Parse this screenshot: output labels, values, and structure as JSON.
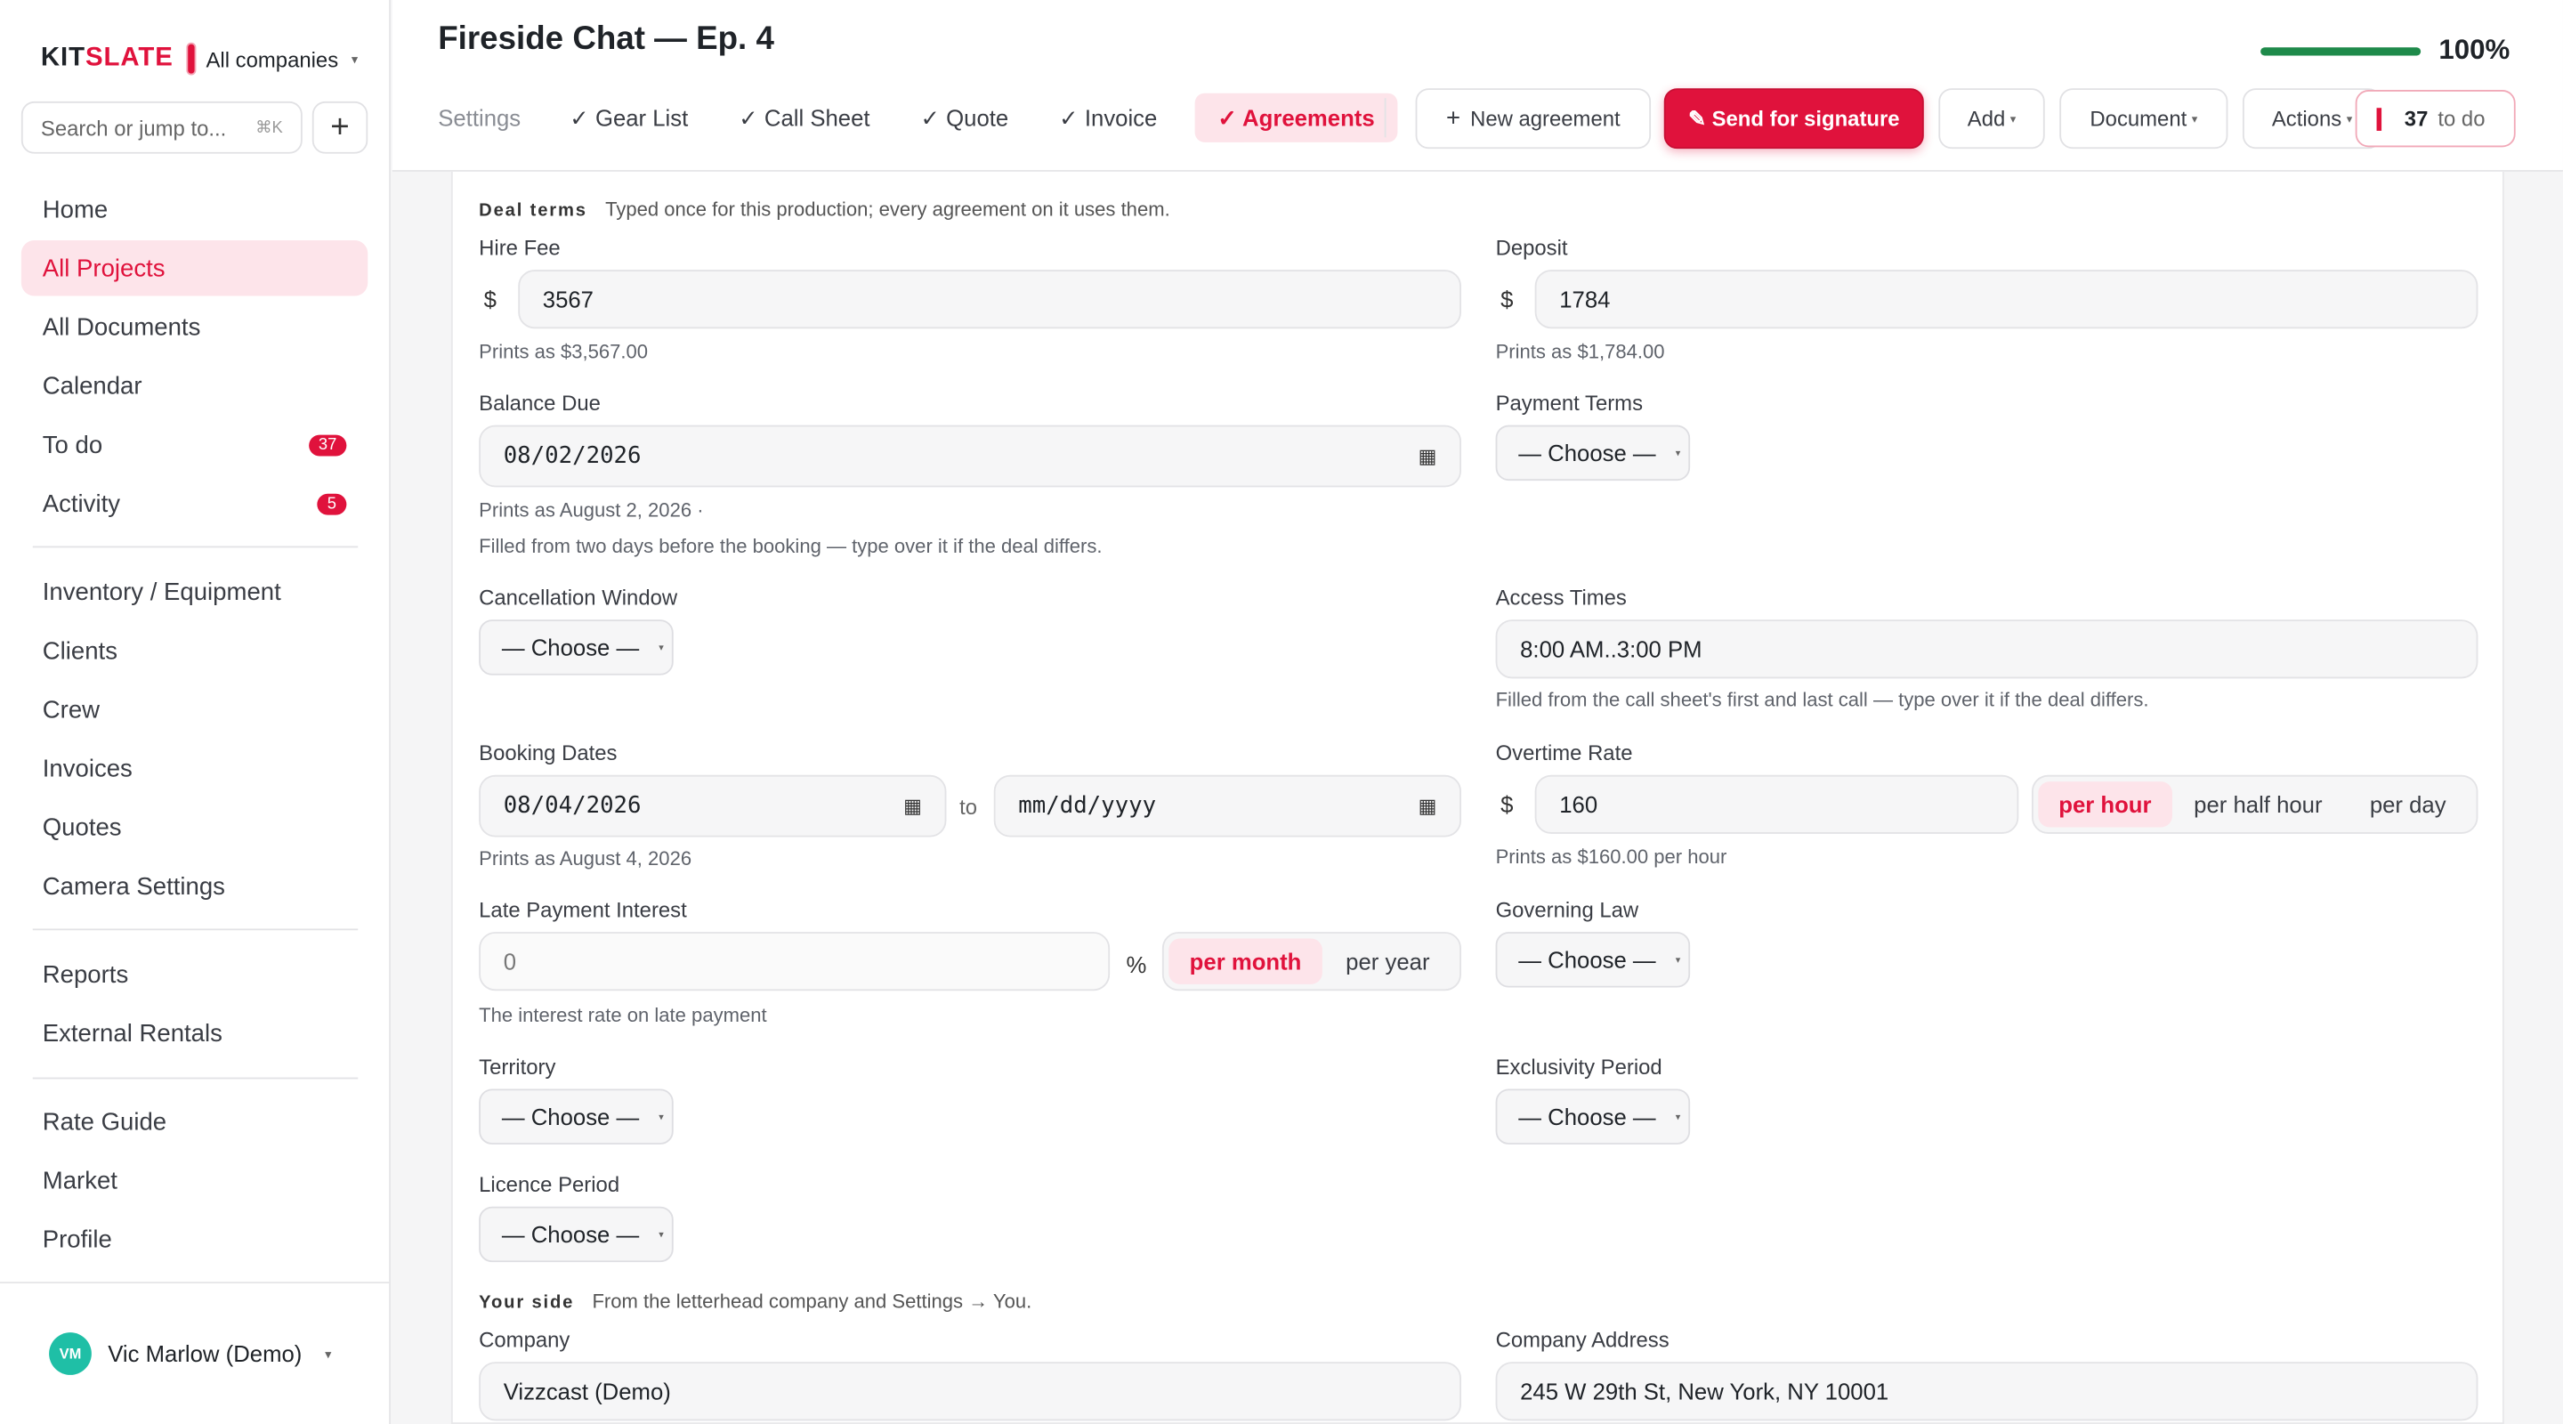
{
  "app": {
    "logo_kit": "KIT",
    "logo_slate": "SLATE",
    "company": "All companies",
    "accent": "#e0123c",
    "success": "#1e8a4a"
  },
  "sidebar": {
    "search_placeholder": "Search or jump to...",
    "search_shortcut": "⌘K",
    "add_icon": "plus-icon",
    "items": [
      {
        "label": "Home"
      },
      {
        "label": "All Projects",
        "active": true
      },
      {
        "label": "All Documents"
      },
      {
        "label": "Calendar"
      },
      {
        "label": "To do",
        "badge": "37"
      },
      {
        "label": "Activity",
        "badge": "5"
      },
      {
        "label": "Inventory / Equipment"
      },
      {
        "label": "Clients"
      },
      {
        "label": "Crew"
      },
      {
        "label": "Invoices"
      },
      {
        "label": "Quotes"
      },
      {
        "label": "Camera Settings"
      },
      {
        "label": "Reports"
      },
      {
        "label": "External Rentals"
      },
      {
        "label": "Rate Guide"
      },
      {
        "label": "Market"
      },
      {
        "label": "Profile"
      }
    ],
    "user": {
      "initials": "VM",
      "name": "Vic Marlow (Demo)"
    }
  },
  "header": {
    "title": "Fireside Chat — Ep. 4",
    "progress_value": 1.0,
    "progress_label": "100%",
    "tabs": [
      {
        "label": "Settings"
      },
      {
        "label": "✓ Gear List"
      },
      {
        "label": "✓ Call Sheet"
      },
      {
        "label": "✓ Quote"
      },
      {
        "label": "✓ Invoice"
      },
      {
        "label": "✓ Agreements",
        "active": true
      }
    ],
    "new_agreement": "New agreement",
    "send_signature": "✎ Send for signature",
    "add": "Add",
    "document": "Document",
    "actions": "Actions",
    "todo_count": "37",
    "todo_label": "to do"
  },
  "deal": {
    "section_title": "Deal terms",
    "section_desc": "Typed once for this production; every agreement on it uses them.",
    "hire_fee": {
      "label": "Hire Fee",
      "currency": "$",
      "value": "3567",
      "help": "Prints as $3,567.00"
    },
    "deposit": {
      "label": "Deposit",
      "currency": "$",
      "value": "1784",
      "help": "Prints as $1,784.00"
    },
    "balance_due": {
      "label": "Balance Due",
      "value": "08/02/2026",
      "help1": "Prints as August 2, 2026 ·",
      "help2": "Filled from two days before the booking — type over it if the deal differs."
    },
    "payment_terms": {
      "label": "Payment Terms",
      "value": "— Choose —"
    },
    "cancellation": {
      "label": "Cancellation Window",
      "value": "— Choose —"
    },
    "access_times": {
      "label": "Access Times",
      "value": "8:00 AM..3:00 PM",
      "help": "Filled from the call sheet's first and last call — type over it if the deal differs."
    },
    "booking_dates": {
      "label": "Booking Dates",
      "from": "08/04/2026",
      "to_word": "to",
      "to": "mm/dd/yyyy",
      "help": "Prints as August 4, 2026"
    },
    "overtime": {
      "label": "Overtime Rate",
      "currency": "$",
      "value": "160",
      "help": "Prints as $160.00 per hour",
      "options": [
        "per hour",
        "per half hour",
        "per day"
      ]
    },
    "late_interest": {
      "label": "Late Payment Interest",
      "placeholder": "0",
      "unit": "%",
      "help": "The interest rate on late payment",
      "options": [
        "per month",
        "per year"
      ]
    },
    "governing_law": {
      "label": "Governing Law",
      "value": "— Choose —"
    },
    "territory": {
      "label": "Territory",
      "value": "— Choose —"
    },
    "exclusivity": {
      "label": "Exclusivity Period",
      "value": "— Choose —"
    },
    "licence": {
      "label": "Licence Period",
      "value": "— Choose —"
    }
  },
  "your_side": {
    "section_title": "Your side",
    "section_desc": "From the letterhead company and Settings → You.",
    "company": {
      "label": "Company",
      "value": "Vizzcast (Demo)"
    },
    "address": {
      "label": "Company Address",
      "value": "245 W 29th St, New York, NY 10001"
    }
  }
}
